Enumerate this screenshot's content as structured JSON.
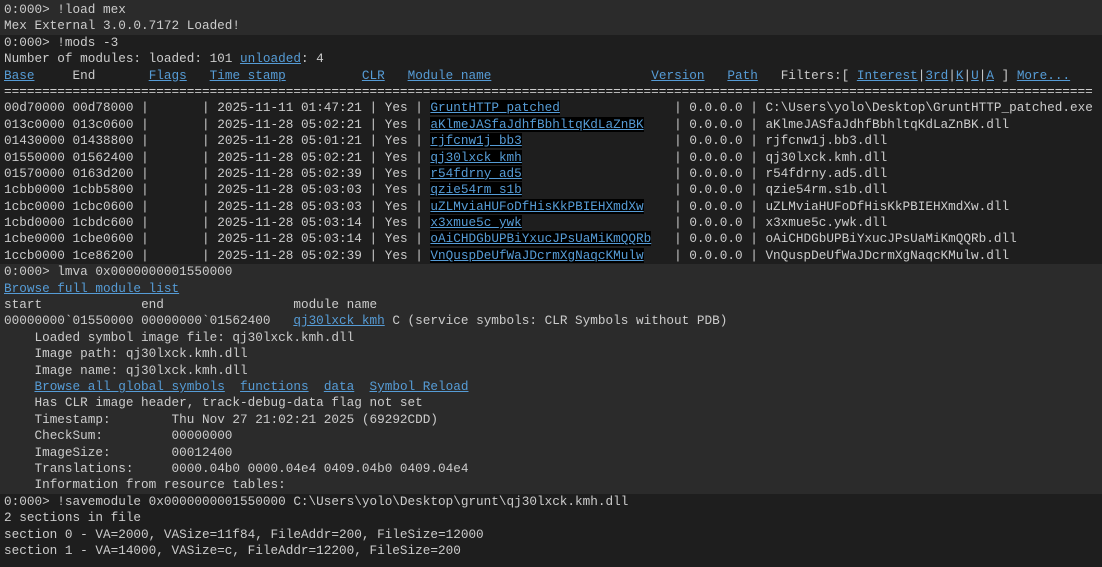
{
  "cmd1": {
    "prompt": "0:000> ",
    "command": "!load mex",
    "output": "Mex External 3.0.0.7172 Loaded!"
  },
  "cmd2": {
    "prompt": "0:000> ",
    "command": "!mods -3",
    "summary_prefix": "Number of modules: loaded: 101 ",
    "unloaded_link": "unloaded",
    "summary_suffix": ": 4",
    "headers": {
      "base": "Base",
      "end": "End",
      "flags": "Flags",
      "timestamp": "Time stamp",
      "clr": "CLR",
      "module_name": "Module name",
      "version": "Version",
      "path": "Path"
    },
    "filters_label": "Filters:[ ",
    "filters": [
      "Interest",
      "3rd",
      "K",
      "U",
      "A"
    ],
    "filters_close": " ] ",
    "more_link": "More...",
    "separator": "===============================================================================================================================================",
    "rows": [
      {
        "base": "00d70000",
        "end": "00d78000",
        "flags": "",
        "timestamp": "2025-11-11 01:47:21",
        "clr": "Yes",
        "name": "GruntHTTP_patched",
        "version": "0.0.0.0",
        "path": "C:\\Users\\yolo\\Desktop\\GruntHTTP_patched.exe"
      },
      {
        "base": "013c0000",
        "end": "013c0600",
        "flags": "",
        "timestamp": "2025-11-28 05:02:21",
        "clr": "Yes",
        "name": "aKlmeJASfaJdhfBbhltqKdLaZnBK",
        "version": "0.0.0.0",
        "path": "aKlmeJASfaJdhfBbhltqKdLaZnBK.dll"
      },
      {
        "base": "01430000",
        "end": "01438800",
        "flags": "",
        "timestamp": "2025-11-28 05:01:21",
        "clr": "Yes",
        "name": "rjfcnw1j_bb3",
        "version": "0.0.0.0",
        "path": "rjfcnw1j.bb3.dll"
      },
      {
        "base": "01550000",
        "end": "01562400",
        "flags": "",
        "timestamp": "2025-11-28 05:02:21",
        "clr": "Yes",
        "name": "qj30lxck_kmh",
        "version": "0.0.0.0",
        "path": "qj30lxck.kmh.dll"
      },
      {
        "base": "01570000",
        "end": "0163d200",
        "flags": "",
        "timestamp": "2025-11-28 05:02:39",
        "clr": "Yes",
        "name": "r54fdrny_ad5",
        "version": "0.0.0.0",
        "path": "r54fdrny.ad5.dll"
      },
      {
        "base": "1cbb0000",
        "end": "1cbb5800",
        "flags": "",
        "timestamp": "2025-11-28 05:03:03",
        "clr": "Yes",
        "name": "qzie54rm_s1b",
        "version": "0.0.0.0",
        "path": "qzie54rm.s1b.dll"
      },
      {
        "base": "1cbc0000",
        "end": "1cbc0600",
        "flags": "",
        "timestamp": "2025-11-28 05:03:03",
        "clr": "Yes",
        "name": "uZLMviaHUFoDfHisKkPBIEHXmdXw",
        "version": "0.0.0.0",
        "path": "uZLMviaHUFoDfHisKkPBIEHXmdXw.dll"
      },
      {
        "base": "1cbd0000",
        "end": "1cbdc600",
        "flags": "",
        "timestamp": "2025-11-28 05:03:14",
        "clr": "Yes",
        "name": "x3xmue5c_ywk",
        "version": "0.0.0.0",
        "path": "x3xmue5c.ywk.dll"
      },
      {
        "base": "1cbe0000",
        "end": "1cbe0600",
        "flags": "",
        "timestamp": "2025-11-28 05:03:14",
        "clr": "Yes",
        "name": "oAiCHDGbUPBiYxucJPsUaMiKmQQRb",
        "version": "0.0.0.0",
        "path": "oAiCHDGbUPBiYxucJPsUaMiKmQQRb.dll"
      },
      {
        "base": "1ccb0000",
        "end": "1ce86200",
        "flags": "",
        "timestamp": "2025-11-28 05:02:39",
        "clr": "Yes",
        "name": "VnQuspDeUfWaJDcrmXgNaqcKMulw",
        "version": "0.0.0.0",
        "path": "VnQuspDeUfWaJDcrmXgNaqcKMulw.dll"
      }
    ]
  },
  "cmd3": {
    "prompt": "0:000> ",
    "command": "lmva 0x0000000001550000",
    "browse_full_link": "Browse full module list",
    "col_start": "start",
    "col_end": "end",
    "col_module": "module name",
    "start": "00000000`01550000",
    "end": "00000000`01562400",
    "module_link": "qj30lxck_kmh",
    "module_info": " C (service symbols: CLR Symbols without PDB)",
    "loaded_symbol": "Loaded symbol image file: qj30lxck.kmh.dll",
    "image_path": "Image path: qj30lxck.kmh.dll",
    "image_name": "Image name: qj30lxck.kmh.dll",
    "links": [
      "Browse all global symbols",
      "functions",
      "data",
      "Symbol Reload"
    ],
    "clr_header": "Has CLR image header, track-debug-data flag not set",
    "timestamp_label": "Timestamp:",
    "timestamp_value": "Thu Nov 27 21:02:21 2025 (69292CDD)",
    "checksum_label": "CheckSum:",
    "checksum_value": "00000000",
    "imagesize_label": "ImageSize:",
    "imagesize_value": "00012400",
    "translations_label": "Translations:",
    "translations_value": "0000.04b0 0000.04e4 0409.04b0 0409.04e4",
    "resource_info": "Information from resource tables:"
  },
  "cmd4": {
    "prompt": "0:000> ",
    "command": "!savemodule 0x0000000001550000 C:\\Users\\yolo\\Desktop\\grunt\\qj30lxck.kmh.dll",
    "lines": [
      "2 sections in file",
      "section 0 - VA=2000, VASize=11f84, FileAddr=200, FileSize=12000",
      "section 1 - VA=14000, VASize=c, FileAddr=12200, FileSize=200"
    ]
  }
}
